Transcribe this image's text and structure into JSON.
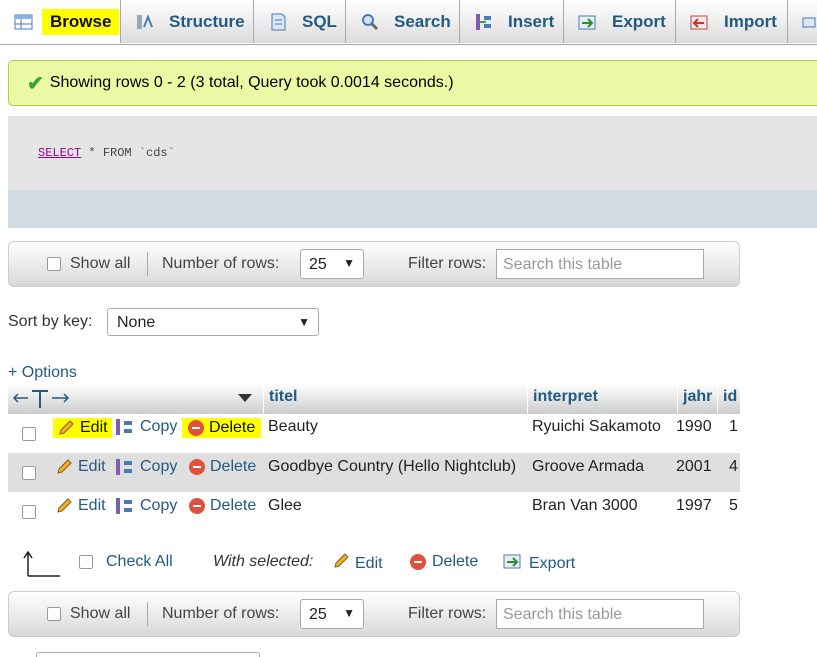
{
  "tabs": [
    {
      "label": "Browse",
      "icon": "table-icon"
    },
    {
      "label": "Structure",
      "icon": "structure-icon"
    },
    {
      "label": "SQL",
      "icon": "sql-icon"
    },
    {
      "label": "Search",
      "icon": "search-icon"
    },
    {
      "label": "Insert",
      "icon": "insert-icon"
    },
    {
      "label": "Export",
      "icon": "export-icon"
    },
    {
      "label": "Import",
      "icon": "import-icon"
    }
  ],
  "success_message": "Showing rows 0 - 2 (3 total, Query took 0.0014 seconds.)",
  "query": {
    "keyword": "SELECT",
    "rest": " * FROM `cds`"
  },
  "nav": {
    "show_all": "Show all",
    "number_of_rows_label": "Number of rows:",
    "number_of_rows_value": "25",
    "filter_label": "Filter rows:",
    "filter_placeholder": "Search this table"
  },
  "sort": {
    "label": "Sort by key:",
    "value": "None"
  },
  "options_link": "+ Options",
  "columns": [
    "titel",
    "interpret",
    "jahr",
    "id"
  ],
  "actions": {
    "edit": "Edit",
    "copy": "Copy",
    "delete": "Delete"
  },
  "rows": [
    {
      "titel": "Beauty",
      "interpret": "Ryuichi Sakamoto",
      "jahr": "1990",
      "id": "1"
    },
    {
      "titel": "Goodbye Country (Hello Nightclub)",
      "interpret": "Groove Armada",
      "jahr": "2001",
      "id": "4"
    },
    {
      "titel": "Glee",
      "interpret": "Bran Van 3000",
      "jahr": "1997",
      "id": "5"
    }
  ],
  "bulk": {
    "check_all": "Check All",
    "with_selected": "With selected:",
    "edit": "Edit",
    "delete": "Delete",
    "export": "Export"
  },
  "colors": {
    "highlight": "#ffff00",
    "link": "#235a81",
    "success_bg": "#ebf8a4",
    "delete_icon": "#e0513c"
  }
}
